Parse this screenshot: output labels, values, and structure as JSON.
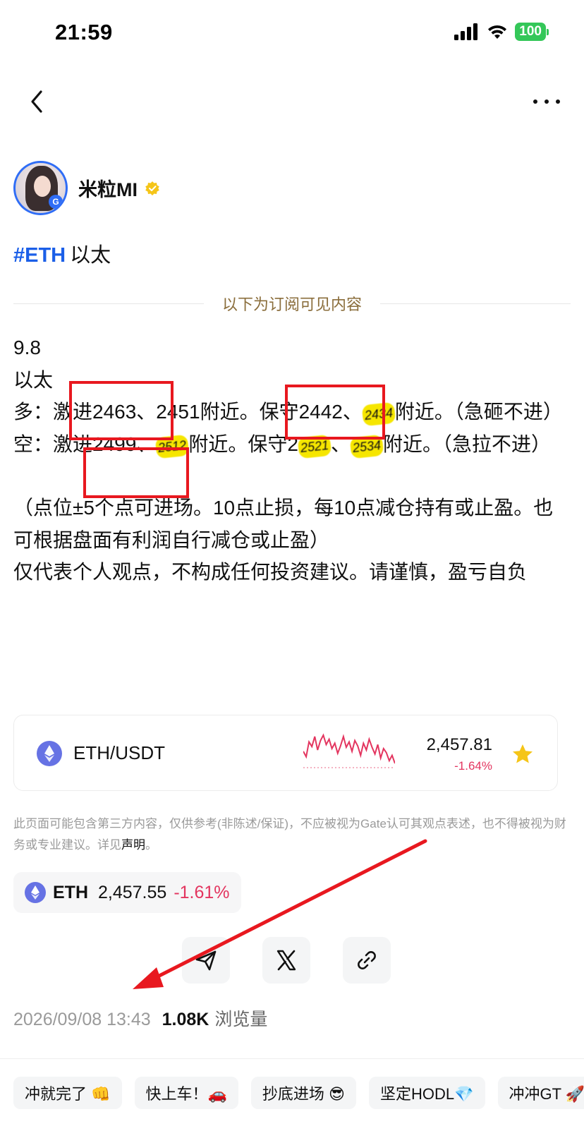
{
  "status_bar": {
    "time": "21:59",
    "battery": "100"
  },
  "author": {
    "name": "米粒MI",
    "avatar_badge": "G"
  },
  "post": {
    "tag": "#ETH",
    "title": "以太",
    "subscriber_divider": "以下为订阅可见内容",
    "lines": {
      "date": "9.8",
      "coin": "以太",
      "long_1": "多：激进2463、2451附近。保守2442、",
      "long_scribble": "2434",
      "long_2": "附近。（急砸不进）",
      "short_1": "空：激进2499、",
      "short_scribble_1": "2512",
      "short_2": "附近。保守2",
      "short_scribble_2": "2521",
      "short_scribble_3": "2534",
      "short_3": "附近。（急拉不进）",
      "note_1": "（点位±5个点可进场。10点止损，每10点减仓持有或止盈。也可根据盘面有利润自行减仓或止盈）",
      "note_2": "仅代表个人观点，不构成任何投资建议。请谨慎，盈亏自负"
    }
  },
  "ticker_card": {
    "pair": "ETH/USDT",
    "price": "2,457.81",
    "change": "-1.64%",
    "sparkline": [
      52,
      60,
      38,
      45,
      30,
      50,
      36,
      28,
      42,
      34,
      48,
      40,
      55,
      44,
      30,
      46,
      38,
      52,
      36,
      44,
      58,
      40,
      50,
      34,
      46,
      56,
      42,
      62,
      48,
      54,
      66,
      58,
      70
    ],
    "colors": {
      "down": "#e3355f",
      "star": "#f5c518",
      "coin": "#6672e4"
    }
  },
  "disclaimer": {
    "text": "此页面可能包含第三方内容，仅供参考(非陈述/保证)，不应被视为Gate认可其观点表述，也不得被视为财务或专业建议。详见",
    "link": "声明",
    "end": "。"
  },
  "coin_chip": {
    "symbol": "ETH",
    "price": "2,457.55",
    "change": "-1.61%"
  },
  "meta": {
    "timestamp": "2026/09/08 13:43",
    "views_count": "1.08K",
    "views_label": "浏览量"
  },
  "reactions": [
    "冲就完了 👊",
    "快上车！🚗",
    "抄底进场 😎",
    "坚定HODL💎",
    "冲冲GT 🚀"
  ],
  "annotation_color": "#e8181f"
}
